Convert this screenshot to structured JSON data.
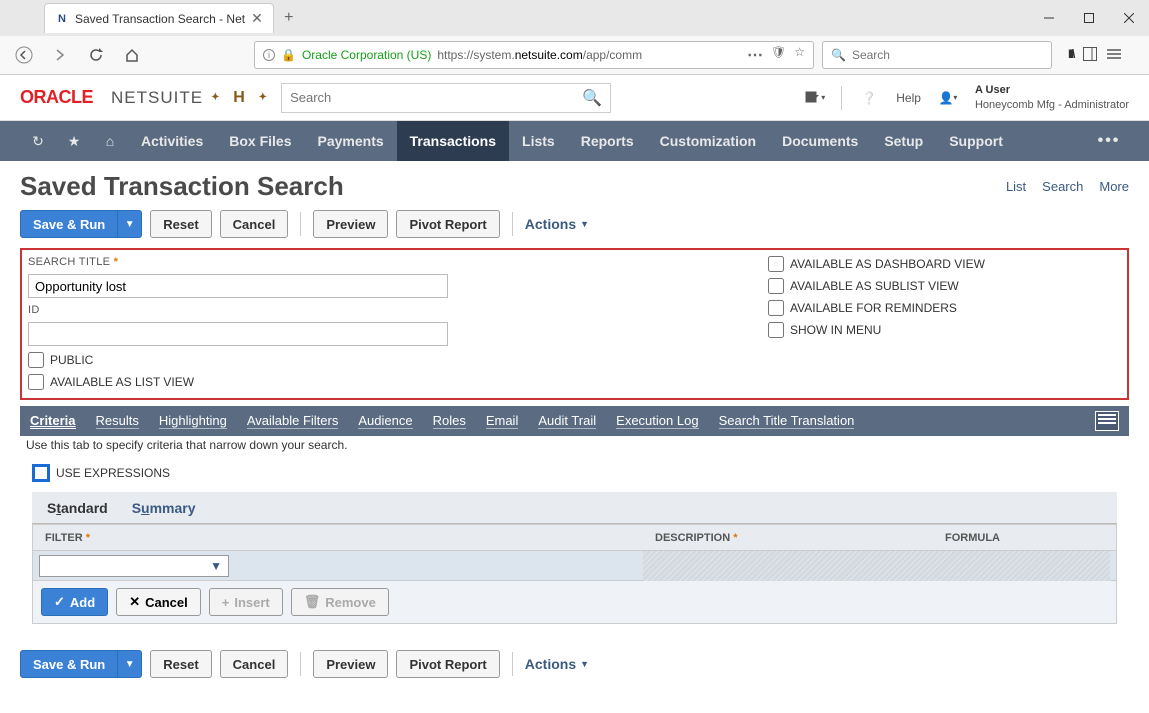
{
  "browser": {
    "tab_title": "Saved Transaction Search - Net",
    "url_identity": "Oracle Corporation (US)",
    "url_prefix": "https://system.",
    "url_host": "netsuite.com",
    "url_path": "/app/comm",
    "search_placeholder": "Search"
  },
  "header": {
    "oracle": "ORACLE",
    "netsuite": "NETSUITE",
    "search_placeholder": "Search",
    "help": "Help",
    "user_name": "A User",
    "user_role": "Honeycomb Mfg - Administrator"
  },
  "nav": {
    "items": [
      "Activities",
      "Box Files",
      "Payments",
      "Transactions",
      "Lists",
      "Reports",
      "Customization",
      "Documents",
      "Setup",
      "Support"
    ],
    "active": "Transactions"
  },
  "page": {
    "title": "Saved Transaction Search",
    "subnav": [
      "List",
      "Search",
      "More"
    ]
  },
  "buttons": {
    "save_run": "Save & Run",
    "reset": "Reset",
    "cancel": "Cancel",
    "preview": "Preview",
    "pivot": "Pivot Report",
    "actions": "Actions"
  },
  "form": {
    "search_title_label": "SEARCH TITLE",
    "search_title_value": "Opportunity lost",
    "id_label": "ID",
    "id_value": "",
    "public": "PUBLIC",
    "avail_list": "AVAILABLE AS LIST VIEW",
    "avail_dash": "AVAILABLE AS DASHBOARD VIEW",
    "avail_sublist": "AVAILABLE AS SUBLIST VIEW",
    "avail_reminders": "AVAILABLE FOR REMINDERS",
    "show_menu": "SHOW IN MENU"
  },
  "subtabs": [
    "Criteria",
    "Results",
    "Highlighting",
    "Available Filters",
    "Audience",
    "Roles",
    "Email",
    "Audit Trail",
    "Execution Log",
    "Search Title Translation"
  ],
  "hint": "Use this tab to specify criteria that narrow down your search.",
  "use_expressions": "USE EXPRESSIONS",
  "inner_tabs": {
    "standard": "Standard",
    "summary": "Summary"
  },
  "table": {
    "filter": "FILTER",
    "description": "DESCRIPTION",
    "formula": "FORMULA"
  },
  "crit_buttons": {
    "add": "Add",
    "cancel": "Cancel",
    "insert": "Insert",
    "remove": "Remove"
  }
}
